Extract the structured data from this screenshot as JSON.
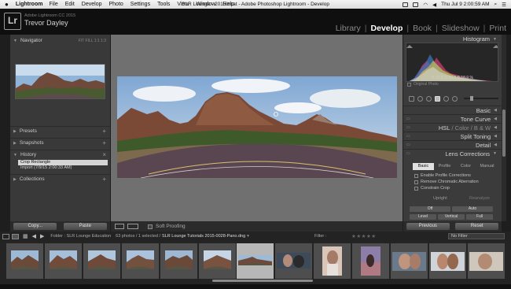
{
  "menubar": {
    "app": "Lightroom",
    "items": [
      "File",
      "Edit",
      "Develop",
      "Photo",
      "Settings",
      "Tools",
      "View",
      "Window",
      "Help"
    ],
    "window_title": "SLR Lounge - 2015.lrcat - Adobe Photoshop Lightroom - Develop",
    "clock": "Thu Jul 9  2:00:59 AM"
  },
  "identity": {
    "logo": "Lr",
    "version": "Adobe Lightroom CC 2015",
    "user": "Trevor Dayley"
  },
  "modules": [
    {
      "label": "Library",
      "active": false
    },
    {
      "label": "Develop",
      "active": true
    },
    {
      "label": "Book",
      "active": false
    },
    {
      "label": "Slideshow",
      "active": false
    },
    {
      "label": "Print",
      "active": false
    }
  ],
  "left_panel": {
    "navigator": {
      "label": "Navigator",
      "zoom": "FIT  FILL  1:1  1:3"
    },
    "presets": "Presets",
    "snapshots": "Snapshots",
    "history": {
      "label": "History",
      "items": [
        {
          "label": "Crop Rectangle",
          "selected": true
        },
        {
          "label": "Import (7/9/15 2:00:33 AM)",
          "selected": false
        }
      ]
    },
    "collections": "Collections",
    "copy_label": "Copy...",
    "paste_label": "Paste"
  },
  "toolbar": {
    "soft_proofing": "Soft Proofing"
  },
  "right_panel": {
    "histogram_label": "Histogram",
    "readout": "R  22.6  G  20.5  B  18.9 %",
    "original_photo": "Original Photo",
    "sections": {
      "basic": "Basic",
      "tone_curve": "Tone Curve",
      "hsl": "HSL",
      "color": "Color",
      "bw": "B & W",
      "split_toning": "Split Toning",
      "detail": "Detail",
      "lens_corrections": "Lens Corrections"
    },
    "lens_tabs": [
      {
        "label": "Basic",
        "active": true
      },
      {
        "label": "Profile",
        "active": false
      },
      {
        "label": "Color",
        "active": false
      },
      {
        "label": "Manual",
        "active": false
      }
    ],
    "lens_checks": [
      "Enable Profile Corrections",
      "Remove Chromatic Aberration",
      "Constrain Crop"
    ],
    "upright_label": "Upright",
    "reanalyze_label": "Reanalyze",
    "off_label": "Off",
    "auto_label": "Auto",
    "level_label": "Level",
    "vertical_label": "Vertical",
    "full_label": "Full",
    "previous_label": "Previous",
    "reset_label": "Reset"
  },
  "filmstrip": {
    "folder": "Folder : SLR Lounge Education",
    "count": "63 photos / 1 selected /",
    "file": "SLR Lounge Tutorials 2015-0028-Pano.dng",
    "filter_label": "Filter :",
    "stars": "★★★★★",
    "no_filter": "No Filter"
  },
  "colors": {
    "panel_bg": "#393939",
    "center_bg": "#707070",
    "selected_item": "#d6d6d6",
    "active_module": "#ffffff"
  }
}
